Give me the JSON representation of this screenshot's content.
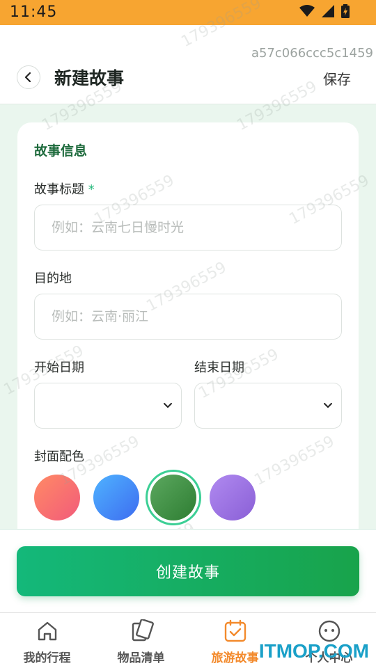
{
  "status_bar": {
    "time": "11:45"
  },
  "header": {
    "id_text": "a57c066ccc5c1459",
    "title": "新建故事",
    "save_label": "保存"
  },
  "form": {
    "section_title": "故事信息",
    "title_field": {
      "label": "故事标题",
      "required_mark": "*",
      "placeholder": "例如：云南七日慢时光"
    },
    "destination_field": {
      "label": "目的地",
      "placeholder": "例如：云南·丽江"
    },
    "start_date": {
      "label": "开始日期"
    },
    "end_date": {
      "label": "结束日期"
    },
    "cover_color": {
      "label": "封面配色",
      "swatches": [
        {
          "name": "coral",
          "from": "#ff8a65",
          "to": "#f25b7a"
        },
        {
          "name": "blue",
          "from": "#4fb3ff",
          "to": "#3d6cf0"
        },
        {
          "name": "green",
          "from": "#5ba85f",
          "to": "#2e7d32",
          "selected": true
        },
        {
          "name": "purple",
          "from": "#b08af0",
          "to": "#8a5fd6"
        }
      ],
      "selected_ring": "#3ccf95"
    }
  },
  "create_button": {
    "label": "创建故事"
  },
  "tabs": [
    {
      "label": "我的行程",
      "icon": "home-icon"
    },
    {
      "label": "物品清单",
      "icon": "cards-icon"
    },
    {
      "label": "旅游故事",
      "icon": "calendar-check-icon",
      "active": true
    },
    {
      "label": "个人中心",
      "icon": "face-icon"
    }
  ],
  "watermark": {
    "number": "179396559",
    "site": "ITMOP.COM"
  },
  "colors": {
    "status_bar": "#f7a531",
    "accent_green": "#18a34b",
    "active_tab": "#f38a2c"
  }
}
